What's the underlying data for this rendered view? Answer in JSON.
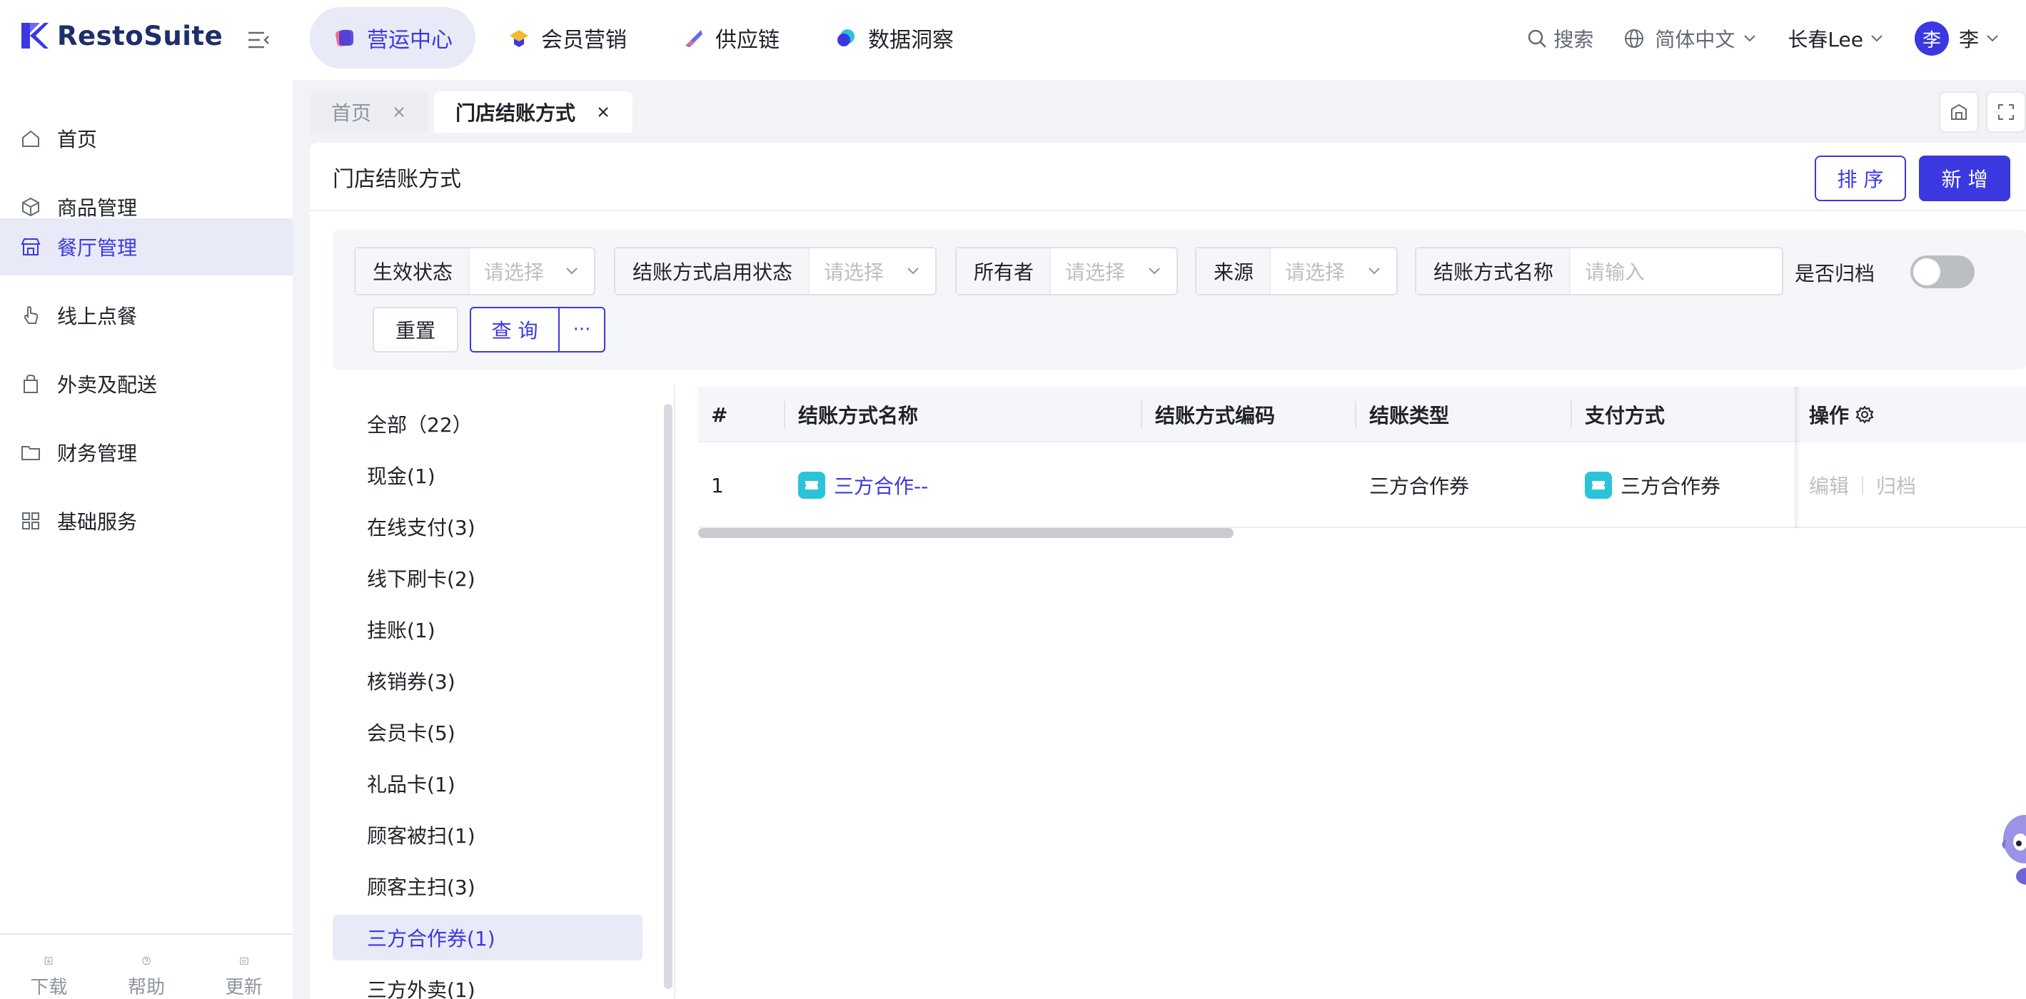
{
  "app": {
    "brand": "RestoSuite",
    "brand_color": "#3c38e0"
  },
  "top_modules": [
    {
      "label": "营运中心",
      "active": true,
      "icon": "ops-center-icon"
    },
    {
      "label": "会员营销",
      "active": false,
      "icon": "member-marketing-icon"
    },
    {
      "label": "供应链",
      "active": false,
      "icon": "supply-chain-icon"
    },
    {
      "label": "数据洞察",
      "active": false,
      "icon": "data-insight-icon"
    }
  ],
  "top_right": {
    "search_label": "搜索",
    "language": "简体中文",
    "store": "长春Lee",
    "avatar_initial": "李",
    "user_name": "李"
  },
  "sidebar": {
    "items": [
      {
        "label": "首页",
        "icon": "home-icon",
        "active": false
      },
      {
        "label": "商品管理",
        "icon": "box-icon",
        "active": false
      },
      {
        "label": "餐厅管理",
        "icon": "store-icon",
        "active": true
      },
      {
        "label": "线上点餐",
        "icon": "tap-icon",
        "active": false
      },
      {
        "label": "外卖及配送",
        "icon": "bag-icon",
        "active": false
      },
      {
        "label": "财务管理",
        "icon": "folder-icon",
        "active": false
      },
      {
        "label": "基础服务",
        "icon": "grid-icon",
        "active": false
      }
    ],
    "bottom": [
      {
        "label": "下载",
        "icon": "download-icon"
      },
      {
        "label": "帮助",
        "icon": "help-icon"
      },
      {
        "label": "更新",
        "icon": "update-icon"
      }
    ]
  },
  "page_tabs": [
    {
      "label": "首页",
      "active": false
    },
    {
      "label": "门店结账方式",
      "active": true
    }
  ],
  "page": {
    "title": "门店结账方式",
    "sort_button": "排 序",
    "add_button": "新 增"
  },
  "filters": {
    "status": {
      "label": "生效状态",
      "placeholder": "请选择"
    },
    "enable_status": {
      "label": "结账方式启用状态",
      "placeholder": "请选择"
    },
    "owner": {
      "label": "所有者",
      "placeholder": "请选择"
    },
    "source": {
      "label": "来源",
      "placeholder": "请选择"
    },
    "name": {
      "label": "结账方式名称",
      "placeholder": "请输入"
    },
    "archive_label": "是否归档",
    "archive_on": false,
    "reset_button": "重置",
    "query_button": "查 询",
    "more_button": "···"
  },
  "categories": [
    {
      "label": "全部（22）",
      "active": false
    },
    {
      "label": "现金(1)",
      "active": false
    },
    {
      "label": "在线支付(3)",
      "active": false
    },
    {
      "label": "线下刷卡(2)",
      "active": false
    },
    {
      "label": "挂账(1)",
      "active": false
    },
    {
      "label": "核销券(3)",
      "active": false
    },
    {
      "label": "会员卡(5)",
      "active": false
    },
    {
      "label": "礼品卡(1)",
      "active": false
    },
    {
      "label": "顾客被扫(1)",
      "active": false
    },
    {
      "label": "顾客主扫(3)",
      "active": false
    },
    {
      "label": "三方合作券(1)",
      "active": true
    },
    {
      "label": "三方外卖(1)",
      "active": false
    }
  ],
  "table": {
    "columns": [
      "#",
      "结账方式名称",
      "结账方式编码",
      "结账类型",
      "支付方式",
      "操作"
    ],
    "rows": [
      {
        "index": "1",
        "name": "三方合作--",
        "code": "",
        "type": "三方合作券",
        "payment": "三方合作券",
        "actions": [
          "编辑",
          "归档"
        ]
      }
    ]
  }
}
